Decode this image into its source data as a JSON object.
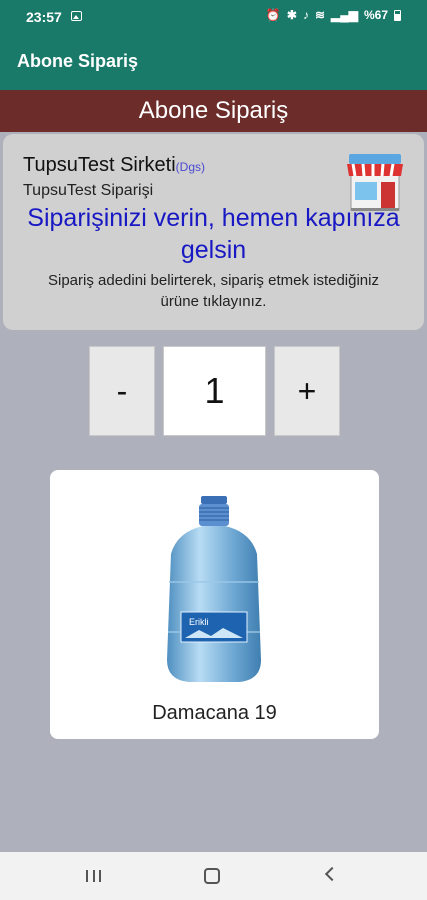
{
  "statusbar": {
    "time": "23:57",
    "battery_text": "%67",
    "icons": [
      "image-icon",
      "alarm-icon",
      "bluetooth-icon",
      "mute-icon",
      "wifi-icon",
      "data-icon",
      "signal-icon",
      "battery-icon"
    ]
  },
  "appbar": {
    "title": "Abone Sipariş"
  },
  "header_band": {
    "title": "Abone Sipariş"
  },
  "info_card": {
    "company": "TupsuTest Sirketi",
    "company_tag": "(Dgs)",
    "subtitle": "TupsuTest Siparişi",
    "slogan": "Siparişinizi verin, hemen kapınıza gelsin",
    "instruction": "Sipariş adedini belirterek, sipariş etmek istediğiniz ürüne tıklayınız."
  },
  "quantity": {
    "minus_label": "-",
    "value": "1",
    "plus_label": "+"
  },
  "product": {
    "name": "Damacana 19",
    "brand_label": "Erikli"
  },
  "colors": {
    "primary": "#1a7a6a",
    "band": "#6b2c2a",
    "background": "#aeb0bc",
    "slogan": "#1818c4"
  }
}
